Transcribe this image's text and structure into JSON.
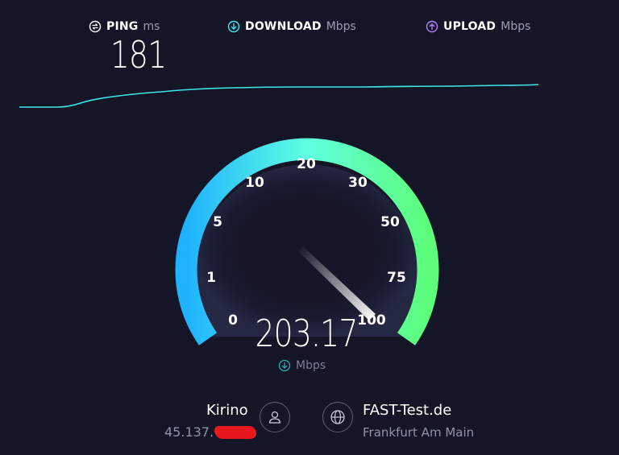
{
  "header": {
    "ping": {
      "label": "PING",
      "unit": "ms",
      "value": "181",
      "icon": "ping-icon"
    },
    "download": {
      "label": "DOWNLOAD",
      "unit": "Mbps",
      "icon": "download-arrow-icon"
    },
    "upload": {
      "label": "UPLOAD",
      "unit": "Mbps",
      "icon": "upload-arrow-icon"
    }
  },
  "gauge": {
    "ticks": [
      "0",
      "1",
      "5",
      "10",
      "20",
      "30",
      "50",
      "75",
      "100"
    ],
    "current_speed": "203.17",
    "unit": "Mbps"
  },
  "provider": {
    "name": "Kirino",
    "ip_prefix": "45.137."
  },
  "server": {
    "name": "FAST-Test.de",
    "location": "Frankfurt Am Main"
  },
  "colors": {
    "background": "#141526",
    "accent_cyan": "#3ee8ec",
    "gauge_start": "#1fb2ff",
    "gauge_end": "#5dfd7a",
    "upload_accent": "#b57bff"
  }
}
